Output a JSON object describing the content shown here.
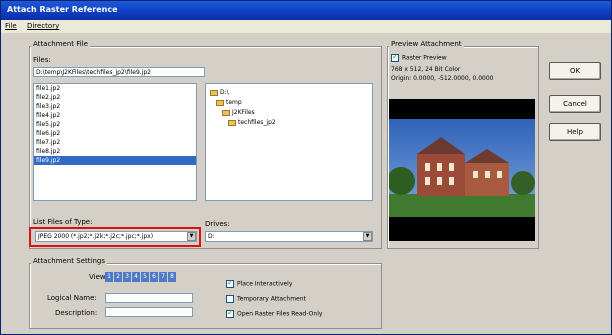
{
  "window": {
    "title": "Attach Raster Reference"
  },
  "menu": [
    "File",
    "Directory"
  ],
  "attachment_file": {
    "group_label": "Attachment File",
    "files_label": "Files:",
    "path": "D:\\temp\\J2KFiles\\techfiles_jp2\\file9.jp2",
    "files": [
      "file1.jp2",
      "file2.jp2",
      "file3.jp2",
      "file4.jp2",
      "file5.jp2",
      "file6.jp2",
      "file7.jp2",
      "file8.jp2",
      "file9.jp2"
    ],
    "selected_index": 8,
    "tree": [
      "D:\\",
      "temp",
      "J2KFiles",
      "techfiles_jp2"
    ],
    "list_type_label": "List Files of Type:",
    "list_type_value": "JPEG 2000 (*.jp2;*.j2k;*.j2c;*.jpc;*.jpx)",
    "drives_label": "Drives:",
    "drives_value": "D:"
  },
  "preview": {
    "group_label": "Preview Attachment",
    "raster_preview_label": "Raster Preview",
    "raster_preview_checked": true,
    "info_size": "768 x 512, 24 Bit Color",
    "info_origin": "Origin: 0.0000, -512.0000, 0.0000"
  },
  "buttons": {
    "ok": "OK",
    "cancel": "Cancel",
    "help": "Help"
  },
  "settings": {
    "group_label": "Attachment Settings",
    "view_label": "View:",
    "views": [
      "1",
      "2",
      "3",
      "4",
      "5",
      "6",
      "7",
      "8"
    ],
    "logical_name_label": "Logical Name:",
    "logical_name_value": "",
    "description_label": "Description:",
    "description_value": "",
    "place_interactively": "Place Interactively",
    "place_interactively_checked": true,
    "temporary_attachment": "Temporary Attachment",
    "temporary_attachment_checked": false,
    "open_readonly": "Open Raster Files Read-Only",
    "open_readonly_checked": true
  }
}
